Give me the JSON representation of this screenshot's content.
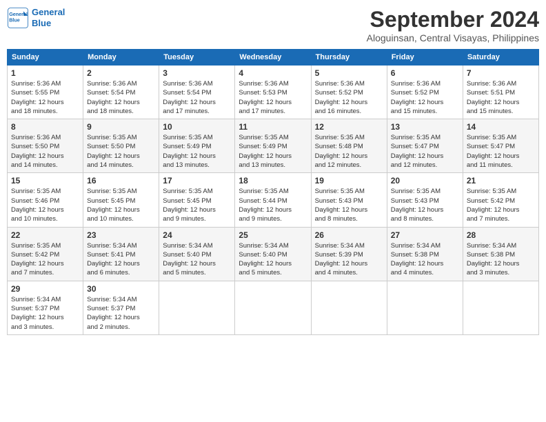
{
  "header": {
    "logo_line1": "General",
    "logo_line2": "Blue",
    "month_title": "September 2024",
    "subtitle": "Aloguinsan, Central Visayas, Philippines"
  },
  "weekdays": [
    "Sunday",
    "Monday",
    "Tuesday",
    "Wednesday",
    "Thursday",
    "Friday",
    "Saturday"
  ],
  "weeks": [
    [
      {
        "day": "1",
        "info": "Sunrise: 5:36 AM\nSunset: 5:55 PM\nDaylight: 12 hours\nand 18 minutes."
      },
      {
        "day": "2",
        "info": "Sunrise: 5:36 AM\nSunset: 5:54 PM\nDaylight: 12 hours\nand 18 minutes."
      },
      {
        "day": "3",
        "info": "Sunrise: 5:36 AM\nSunset: 5:54 PM\nDaylight: 12 hours\nand 17 minutes."
      },
      {
        "day": "4",
        "info": "Sunrise: 5:36 AM\nSunset: 5:53 PM\nDaylight: 12 hours\nand 17 minutes."
      },
      {
        "day": "5",
        "info": "Sunrise: 5:36 AM\nSunset: 5:52 PM\nDaylight: 12 hours\nand 16 minutes."
      },
      {
        "day": "6",
        "info": "Sunrise: 5:36 AM\nSunset: 5:52 PM\nDaylight: 12 hours\nand 15 minutes."
      },
      {
        "day": "7",
        "info": "Sunrise: 5:36 AM\nSunset: 5:51 PM\nDaylight: 12 hours\nand 15 minutes."
      }
    ],
    [
      {
        "day": "8",
        "info": "Sunrise: 5:36 AM\nSunset: 5:50 PM\nDaylight: 12 hours\nand 14 minutes."
      },
      {
        "day": "9",
        "info": "Sunrise: 5:35 AM\nSunset: 5:50 PM\nDaylight: 12 hours\nand 14 minutes."
      },
      {
        "day": "10",
        "info": "Sunrise: 5:35 AM\nSunset: 5:49 PM\nDaylight: 12 hours\nand 13 minutes."
      },
      {
        "day": "11",
        "info": "Sunrise: 5:35 AM\nSunset: 5:49 PM\nDaylight: 12 hours\nand 13 minutes."
      },
      {
        "day": "12",
        "info": "Sunrise: 5:35 AM\nSunset: 5:48 PM\nDaylight: 12 hours\nand 12 minutes."
      },
      {
        "day": "13",
        "info": "Sunrise: 5:35 AM\nSunset: 5:47 PM\nDaylight: 12 hours\nand 12 minutes."
      },
      {
        "day": "14",
        "info": "Sunrise: 5:35 AM\nSunset: 5:47 PM\nDaylight: 12 hours\nand 11 minutes."
      }
    ],
    [
      {
        "day": "15",
        "info": "Sunrise: 5:35 AM\nSunset: 5:46 PM\nDaylight: 12 hours\nand 10 minutes."
      },
      {
        "day": "16",
        "info": "Sunrise: 5:35 AM\nSunset: 5:45 PM\nDaylight: 12 hours\nand 10 minutes."
      },
      {
        "day": "17",
        "info": "Sunrise: 5:35 AM\nSunset: 5:45 PM\nDaylight: 12 hours\nand 9 minutes."
      },
      {
        "day": "18",
        "info": "Sunrise: 5:35 AM\nSunset: 5:44 PM\nDaylight: 12 hours\nand 9 minutes."
      },
      {
        "day": "19",
        "info": "Sunrise: 5:35 AM\nSunset: 5:43 PM\nDaylight: 12 hours\nand 8 minutes."
      },
      {
        "day": "20",
        "info": "Sunrise: 5:35 AM\nSunset: 5:43 PM\nDaylight: 12 hours\nand 8 minutes."
      },
      {
        "day": "21",
        "info": "Sunrise: 5:35 AM\nSunset: 5:42 PM\nDaylight: 12 hours\nand 7 minutes."
      }
    ],
    [
      {
        "day": "22",
        "info": "Sunrise: 5:35 AM\nSunset: 5:42 PM\nDaylight: 12 hours\nand 7 minutes."
      },
      {
        "day": "23",
        "info": "Sunrise: 5:34 AM\nSunset: 5:41 PM\nDaylight: 12 hours\nand 6 minutes."
      },
      {
        "day": "24",
        "info": "Sunrise: 5:34 AM\nSunset: 5:40 PM\nDaylight: 12 hours\nand 5 minutes."
      },
      {
        "day": "25",
        "info": "Sunrise: 5:34 AM\nSunset: 5:40 PM\nDaylight: 12 hours\nand 5 minutes."
      },
      {
        "day": "26",
        "info": "Sunrise: 5:34 AM\nSunset: 5:39 PM\nDaylight: 12 hours\nand 4 minutes."
      },
      {
        "day": "27",
        "info": "Sunrise: 5:34 AM\nSunset: 5:38 PM\nDaylight: 12 hours\nand 4 minutes."
      },
      {
        "day": "28",
        "info": "Sunrise: 5:34 AM\nSunset: 5:38 PM\nDaylight: 12 hours\nand 3 minutes."
      }
    ],
    [
      {
        "day": "29",
        "info": "Sunrise: 5:34 AM\nSunset: 5:37 PM\nDaylight: 12 hours\nand 3 minutes."
      },
      {
        "day": "30",
        "info": "Sunrise: 5:34 AM\nSunset: 5:37 PM\nDaylight: 12 hours\nand 2 minutes."
      },
      {
        "day": "",
        "info": ""
      },
      {
        "day": "",
        "info": ""
      },
      {
        "day": "",
        "info": ""
      },
      {
        "day": "",
        "info": ""
      },
      {
        "day": "",
        "info": ""
      }
    ]
  ]
}
